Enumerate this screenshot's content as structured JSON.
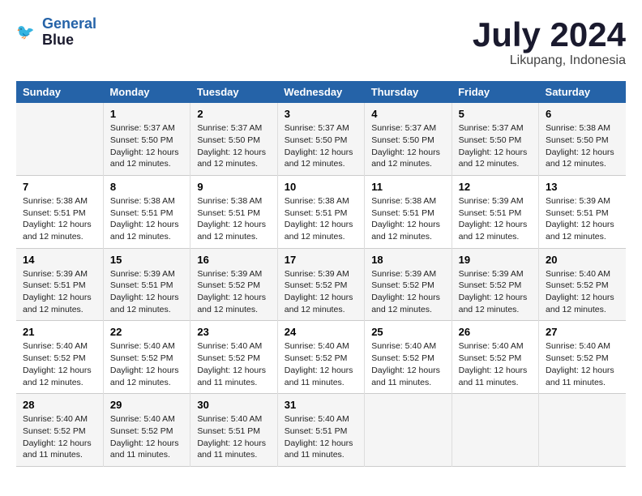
{
  "logo": {
    "line1": "General",
    "line2": "Blue"
  },
  "title": "July 2024",
  "subtitle": "Likupang, Indonesia",
  "header": {
    "days": [
      "Sunday",
      "Monday",
      "Tuesday",
      "Wednesday",
      "Thursday",
      "Friday",
      "Saturday"
    ]
  },
  "weeks": [
    [
      {
        "day": "",
        "info": ""
      },
      {
        "day": "1",
        "info": "Sunrise: 5:37 AM\nSunset: 5:50 PM\nDaylight: 12 hours\nand 12 minutes."
      },
      {
        "day": "2",
        "info": "Sunrise: 5:37 AM\nSunset: 5:50 PM\nDaylight: 12 hours\nand 12 minutes."
      },
      {
        "day": "3",
        "info": "Sunrise: 5:37 AM\nSunset: 5:50 PM\nDaylight: 12 hours\nand 12 minutes."
      },
      {
        "day": "4",
        "info": "Sunrise: 5:37 AM\nSunset: 5:50 PM\nDaylight: 12 hours\nand 12 minutes."
      },
      {
        "day": "5",
        "info": "Sunrise: 5:37 AM\nSunset: 5:50 PM\nDaylight: 12 hours\nand 12 minutes."
      },
      {
        "day": "6",
        "info": "Sunrise: 5:38 AM\nSunset: 5:50 PM\nDaylight: 12 hours\nand 12 minutes."
      }
    ],
    [
      {
        "day": "7",
        "info": "Sunrise: 5:38 AM\nSunset: 5:51 PM\nDaylight: 12 hours\nand 12 minutes."
      },
      {
        "day": "8",
        "info": "Sunrise: 5:38 AM\nSunset: 5:51 PM\nDaylight: 12 hours\nand 12 minutes."
      },
      {
        "day": "9",
        "info": "Sunrise: 5:38 AM\nSunset: 5:51 PM\nDaylight: 12 hours\nand 12 minutes."
      },
      {
        "day": "10",
        "info": "Sunrise: 5:38 AM\nSunset: 5:51 PM\nDaylight: 12 hours\nand 12 minutes."
      },
      {
        "day": "11",
        "info": "Sunrise: 5:38 AM\nSunset: 5:51 PM\nDaylight: 12 hours\nand 12 minutes."
      },
      {
        "day": "12",
        "info": "Sunrise: 5:39 AM\nSunset: 5:51 PM\nDaylight: 12 hours\nand 12 minutes."
      },
      {
        "day": "13",
        "info": "Sunrise: 5:39 AM\nSunset: 5:51 PM\nDaylight: 12 hours\nand 12 minutes."
      }
    ],
    [
      {
        "day": "14",
        "info": "Sunrise: 5:39 AM\nSunset: 5:51 PM\nDaylight: 12 hours\nand 12 minutes."
      },
      {
        "day": "15",
        "info": "Sunrise: 5:39 AM\nSunset: 5:51 PM\nDaylight: 12 hours\nand 12 minutes."
      },
      {
        "day": "16",
        "info": "Sunrise: 5:39 AM\nSunset: 5:52 PM\nDaylight: 12 hours\nand 12 minutes."
      },
      {
        "day": "17",
        "info": "Sunrise: 5:39 AM\nSunset: 5:52 PM\nDaylight: 12 hours\nand 12 minutes."
      },
      {
        "day": "18",
        "info": "Sunrise: 5:39 AM\nSunset: 5:52 PM\nDaylight: 12 hours\nand 12 minutes."
      },
      {
        "day": "19",
        "info": "Sunrise: 5:39 AM\nSunset: 5:52 PM\nDaylight: 12 hours\nand 12 minutes."
      },
      {
        "day": "20",
        "info": "Sunrise: 5:40 AM\nSunset: 5:52 PM\nDaylight: 12 hours\nand 12 minutes."
      }
    ],
    [
      {
        "day": "21",
        "info": "Sunrise: 5:40 AM\nSunset: 5:52 PM\nDaylight: 12 hours\nand 12 minutes."
      },
      {
        "day": "22",
        "info": "Sunrise: 5:40 AM\nSunset: 5:52 PM\nDaylight: 12 hours\nand 12 minutes."
      },
      {
        "day": "23",
        "info": "Sunrise: 5:40 AM\nSunset: 5:52 PM\nDaylight: 12 hours\nand 11 minutes."
      },
      {
        "day": "24",
        "info": "Sunrise: 5:40 AM\nSunset: 5:52 PM\nDaylight: 12 hours\nand 11 minutes."
      },
      {
        "day": "25",
        "info": "Sunrise: 5:40 AM\nSunset: 5:52 PM\nDaylight: 12 hours\nand 11 minutes."
      },
      {
        "day": "26",
        "info": "Sunrise: 5:40 AM\nSunset: 5:52 PM\nDaylight: 12 hours\nand 11 minutes."
      },
      {
        "day": "27",
        "info": "Sunrise: 5:40 AM\nSunset: 5:52 PM\nDaylight: 12 hours\nand 11 minutes."
      }
    ],
    [
      {
        "day": "28",
        "info": "Sunrise: 5:40 AM\nSunset: 5:52 PM\nDaylight: 12 hours\nand 11 minutes."
      },
      {
        "day": "29",
        "info": "Sunrise: 5:40 AM\nSunset: 5:52 PM\nDaylight: 12 hours\nand 11 minutes."
      },
      {
        "day": "30",
        "info": "Sunrise: 5:40 AM\nSunset: 5:51 PM\nDaylight: 12 hours\nand 11 minutes."
      },
      {
        "day": "31",
        "info": "Sunrise: 5:40 AM\nSunset: 5:51 PM\nDaylight: 12 hours\nand 11 minutes."
      },
      {
        "day": "",
        "info": ""
      },
      {
        "day": "",
        "info": ""
      },
      {
        "day": "",
        "info": ""
      }
    ]
  ]
}
